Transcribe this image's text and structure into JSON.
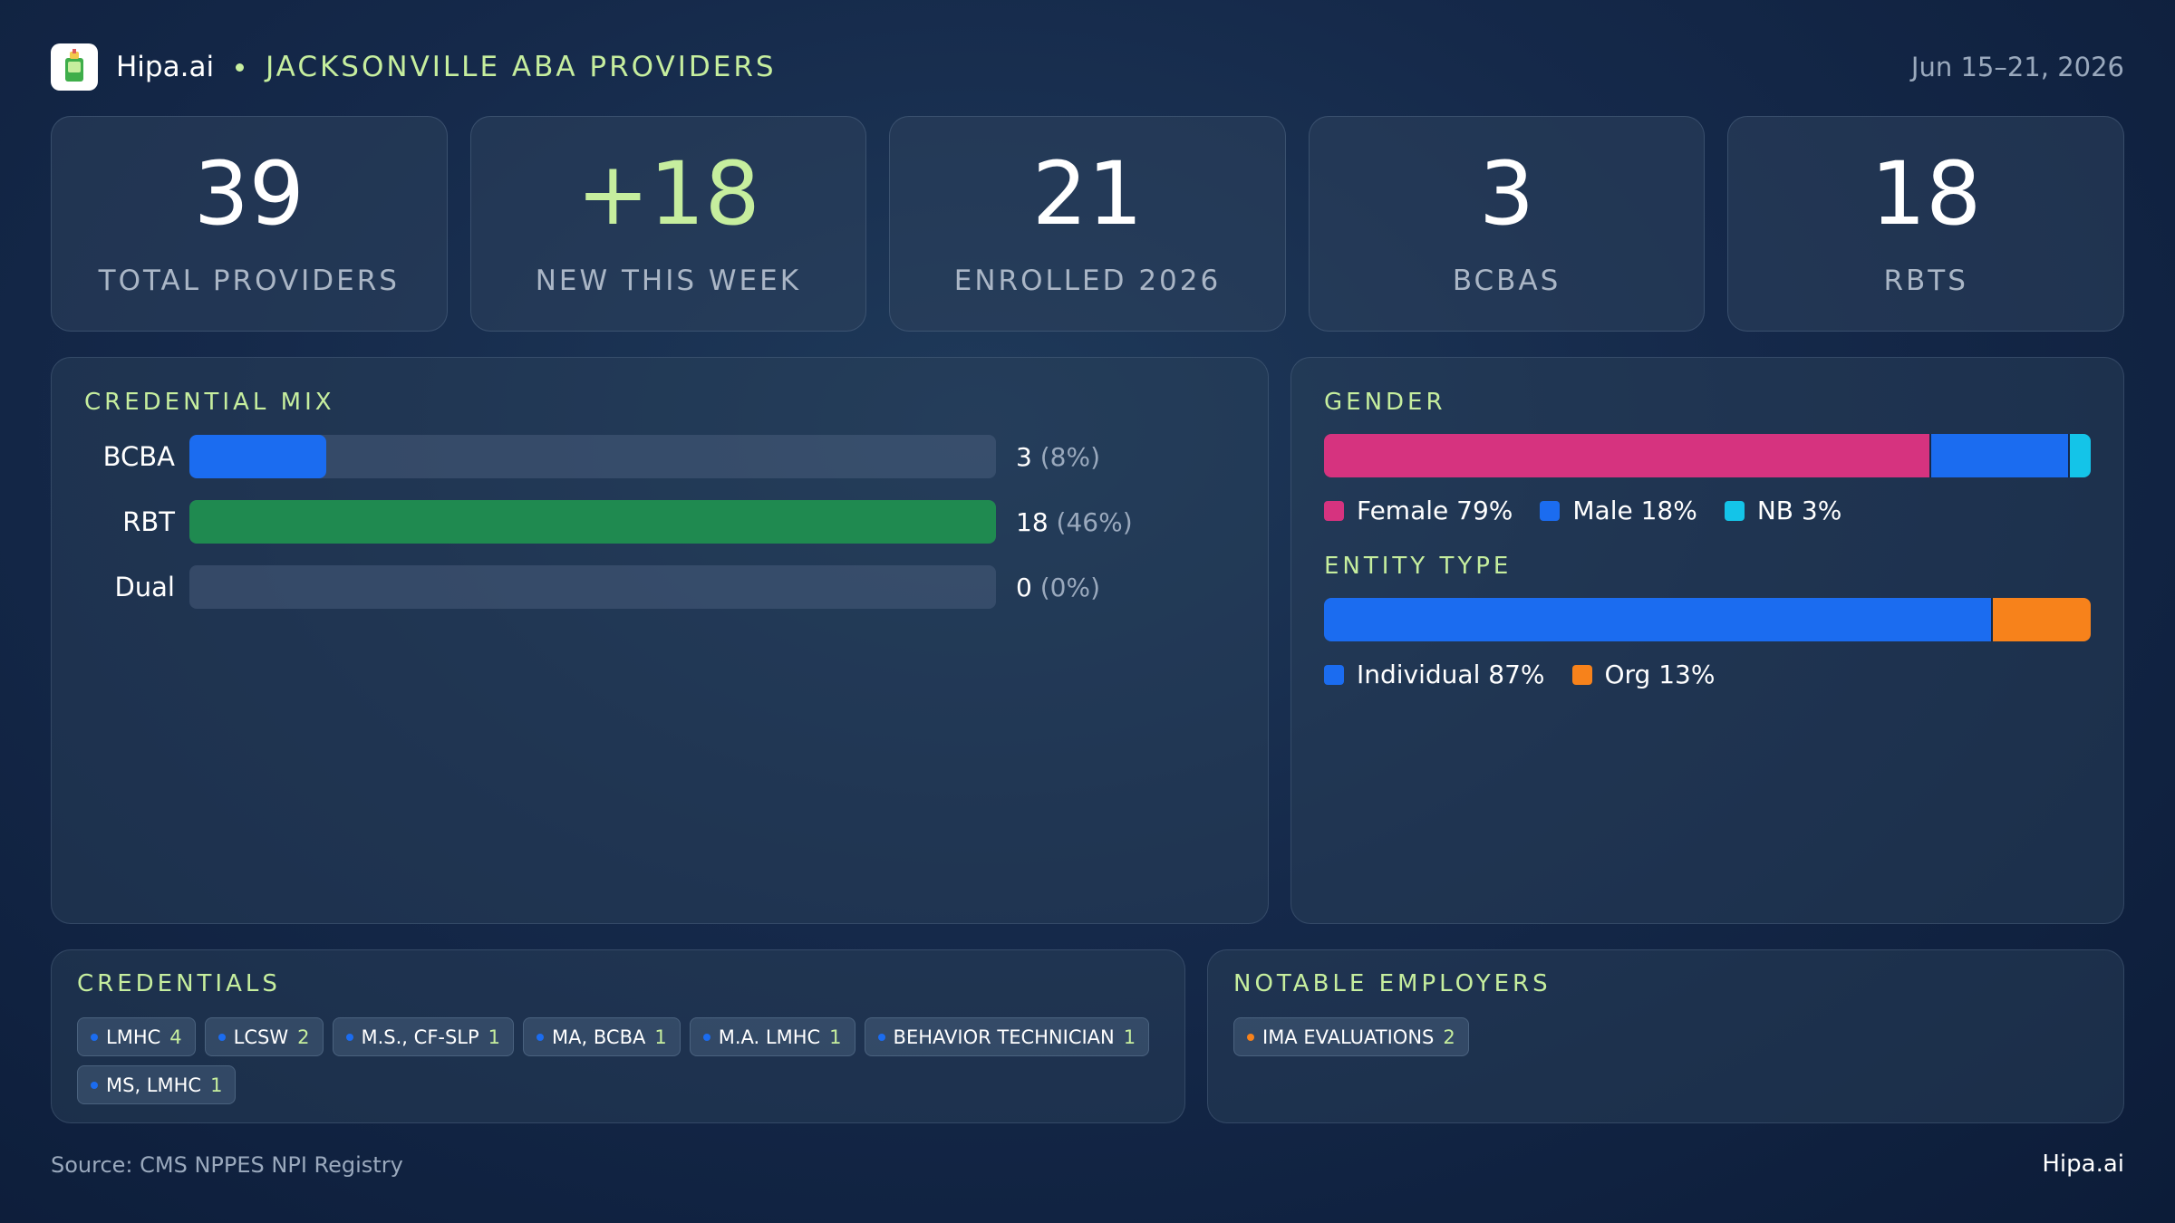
{
  "header": {
    "brand": "Hipa.ai",
    "title": "JACKSONVILLE ABA PROVIDERS",
    "date": "Jun 15–21, 2026"
  },
  "stats": [
    {
      "value": "39",
      "label": "TOTAL PROVIDERS"
    },
    {
      "value": "+18",
      "label": "NEW THIS WEEK"
    },
    {
      "value": "21",
      "label": "ENROLLED 2026"
    },
    {
      "value": "3",
      "label": "BCBAS"
    },
    {
      "value": "18",
      "label": "RBTS"
    }
  ],
  "credential_mix": {
    "title": "CREDENTIAL MIX",
    "rows": [
      {
        "label": "BCBA",
        "count": "3",
        "pct_text": "(8%)",
        "fraction": 0.17,
        "color": "#1b6cf0"
      },
      {
        "label": "RBT",
        "count": "18",
        "pct_text": "(46%)",
        "fraction": 1.0,
        "color": "#1f8a50"
      },
      {
        "label": "Dual",
        "count": "0",
        "pct_text": "(0%)",
        "fraction": 0.0,
        "color": "#1b6cf0"
      }
    ]
  },
  "gender": {
    "title": "GENDER",
    "segments": [
      {
        "label": "Female 79%",
        "fraction": 0.79,
        "color": "#d6337f"
      },
      {
        "label": "Male 18%",
        "fraction": 0.18,
        "color": "#1b6cf0"
      },
      {
        "label": "NB 3%",
        "fraction": 0.03,
        "color": "#14c4e8"
      }
    ]
  },
  "entity_type": {
    "title": "ENTITY TYPE",
    "segments": [
      {
        "label": "Individual 87%",
        "fraction": 0.87,
        "color": "#1b6cf0"
      },
      {
        "label": "Org 13%",
        "fraction": 0.13,
        "color": "#f7821b"
      }
    ]
  },
  "credentials": {
    "title": "CREDENTIALS",
    "chips": [
      {
        "label": "LMHC",
        "count": "4"
      },
      {
        "label": "LCSW",
        "count": "2"
      },
      {
        "label": "M.S., CF-SLP",
        "count": "1"
      },
      {
        "label": "MA, BCBA",
        "count": "1"
      },
      {
        "label": "M.A. LMHC",
        "count": "1"
      },
      {
        "label": "BEHAVIOR TECHNICIAN",
        "count": "1"
      },
      {
        "label": "MS, LMHC",
        "count": "1"
      }
    ],
    "dot_color": "#1b6cf0"
  },
  "notable_employers": {
    "title": "NOTABLE EMPLOYERS",
    "chips": [
      {
        "label": "IMA EVALUATIONS",
        "count": "2"
      }
    ],
    "dot_color": "#f7821b"
  },
  "footer": {
    "source": "Source: CMS NPPES NPI Registry",
    "brand": "Hipa.ai"
  }
}
